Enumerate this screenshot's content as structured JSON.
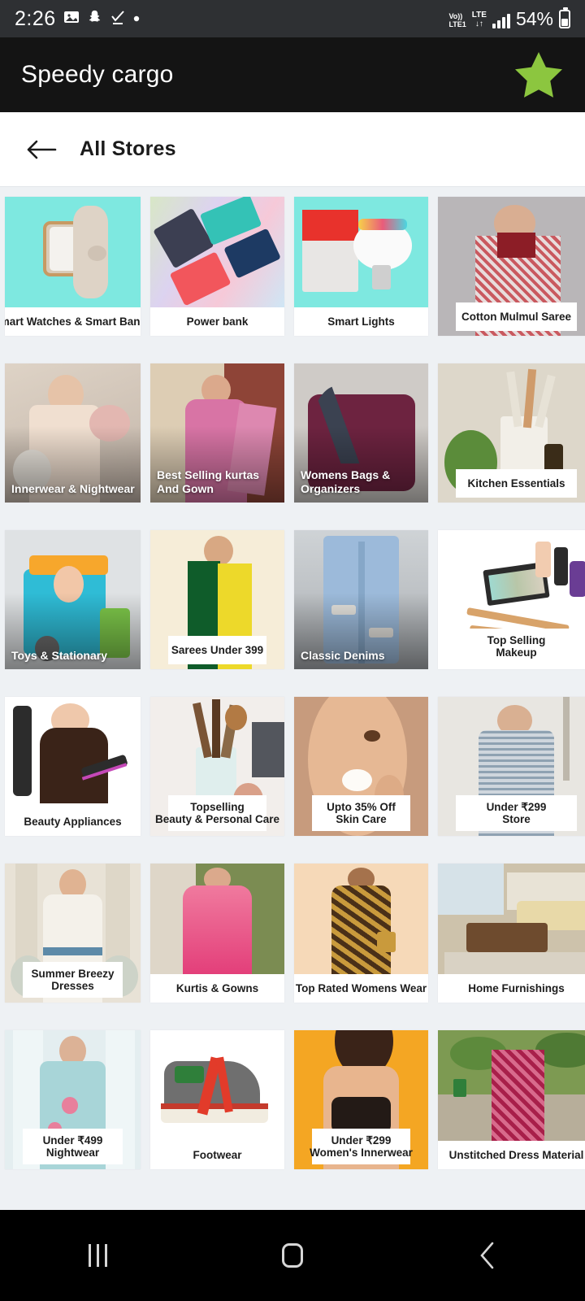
{
  "status_bar": {
    "clock": "2:26",
    "left_icons": [
      "image-icon",
      "snapchat-icon",
      "check-icon",
      "dot-icon"
    ],
    "volte_line1": "Vo))",
    "volte_line2": "LTE1",
    "lte_label": "LTE",
    "lte_arrows": "↓↑",
    "battery_percent": "54%",
    "signal_bars": 4
  },
  "app_bar": {
    "title": "Speedy cargo",
    "star_color": "#8CC63F",
    "star_icon": "star-icon"
  },
  "sub_header": {
    "back_icon": "arrow-left-icon",
    "title": "All Stores"
  },
  "nav_bar": {
    "recents_icon": "recents-icon",
    "home_icon": "home-icon",
    "back_icon": "back-chevron-icon"
  },
  "colors": {
    "page_background": "#eef1f4",
    "app_bar_background": "#141414",
    "status_bar_background": "#2e3033",
    "card_background": "#ffffff",
    "accent_green": "#8CC63F"
  },
  "store_grid": {
    "columns": 4,
    "items": [
      {
        "line1": "Smart Watches & Smart Bands",
        "line2": "",
        "caption_style": "below",
        "thumb": "smart-watch",
        "bg": "#7ee8e0"
      },
      {
        "line1": "Power bank",
        "line2": "",
        "caption_style": "below",
        "thumb": "power-banks",
        "bg": "#e9f3e2"
      },
      {
        "line1": "Smart Lights",
        "line2": "",
        "caption_style": "below",
        "thumb": "smart-bulb",
        "bg": "#7ee8e0"
      },
      {
        "line1": "Cotton Mulmul Saree",
        "line2": "",
        "caption_style": "inset",
        "thumb": "saree-model",
        "bg": "#b9b6b8"
      },
      {
        "line1": "Innerwear & Nightwear",
        "line2": "",
        "caption_style": "overlay",
        "thumb": "nightwear-model",
        "bg": "#cbb9ac"
      },
      {
        "line1": "Best Selling kurtas",
        "line2": "And Gown",
        "caption_style": "overlay",
        "thumb": "kurta-model",
        "bg": "#c7a58f"
      },
      {
        "line1": "Womens Bags & Organizers",
        "line2": "",
        "caption_style": "overlay",
        "thumb": "handbag",
        "bg": "#6d2340"
      },
      {
        "line1": "Kitchen Essentials",
        "line2": "",
        "caption_style": "inset",
        "thumb": "kitchen-utensils",
        "bg": "#d9d3c6"
      },
      {
        "line1": "Toys & Stationary",
        "line2": "",
        "caption_style": "overlay",
        "thumb": "toy-kitchen-cart",
        "bg": "#dfe2e4"
      },
      {
        "line1": "Sarees Under 399",
        "line2": "",
        "caption_style": "inset",
        "thumb": "green-yellow-saree",
        "bg": "#f6edd8"
      },
      {
        "line1": "Classic Denims",
        "line2": "",
        "caption_style": "overlay",
        "thumb": "denim-jeans",
        "bg": "#cfd3d6"
      },
      {
        "line1": "Top Selling",
        "line2": "Makeup",
        "caption_style": "inset-two",
        "thumb": "makeup-palette",
        "bg": "#ffffff"
      },
      {
        "line1": "Beauty Appliances",
        "line2": "",
        "caption_style": "below",
        "thumb": "hair-straightener",
        "bg": "#ffffff"
      },
      {
        "line1": "Topselling",
        "line2": "Beauty & Personal Care",
        "caption_style": "inset-two",
        "thumb": "makeup-brushes",
        "bg": "#f2eeeb"
      },
      {
        "line1": "Upto 35% Off",
        "line2": "Skin Care",
        "caption_style": "inset-two",
        "thumb": "skincare-face",
        "bg": "#c79b7d"
      },
      {
        "line1": "Under ₹299",
        "line2": "Store",
        "caption_style": "inset-two",
        "thumb": "printed-dress",
        "bg": "#e8e6e1"
      },
      {
        "line1": "Summer Breezy",
        "line2": "Dresses",
        "caption_style": "inset-two",
        "thumb": "floral-dress",
        "bg": "#e3ded4"
      },
      {
        "line1": "Kurtis & Gowns",
        "line2": "",
        "caption_style": "below",
        "thumb": "pink-gown",
        "bg": "#7b8c52"
      },
      {
        "line1": "Top Rated Womens Wear",
        "line2": "",
        "caption_style": "below",
        "thumb": "printed-gown",
        "bg": "#f6d9b8"
      },
      {
        "line1": "Home Furnishings",
        "line2": "",
        "caption_style": "below",
        "thumb": "living-room",
        "bg": "#cdc2ab"
      },
      {
        "line1": "Under ₹499",
        "line2": "Nightwear",
        "caption_style": "inset-two",
        "thumb": "nightwear-set",
        "bg": "#d9e7e8"
      },
      {
        "line1": "Footwear",
        "line2": "",
        "caption_style": "below",
        "thumb": "sneaker",
        "bg": "#ffffff"
      },
      {
        "line1": "Under ₹299",
        "line2": "Women's Innerwear",
        "caption_style": "inset-two",
        "thumb": "innerwear-model",
        "bg": "#f4a623"
      },
      {
        "line1": "Unstitched Dress Material",
        "line2": "",
        "caption_style": "below",
        "thumb": "dress-material",
        "bg": "#7d9a52"
      }
    ]
  }
}
